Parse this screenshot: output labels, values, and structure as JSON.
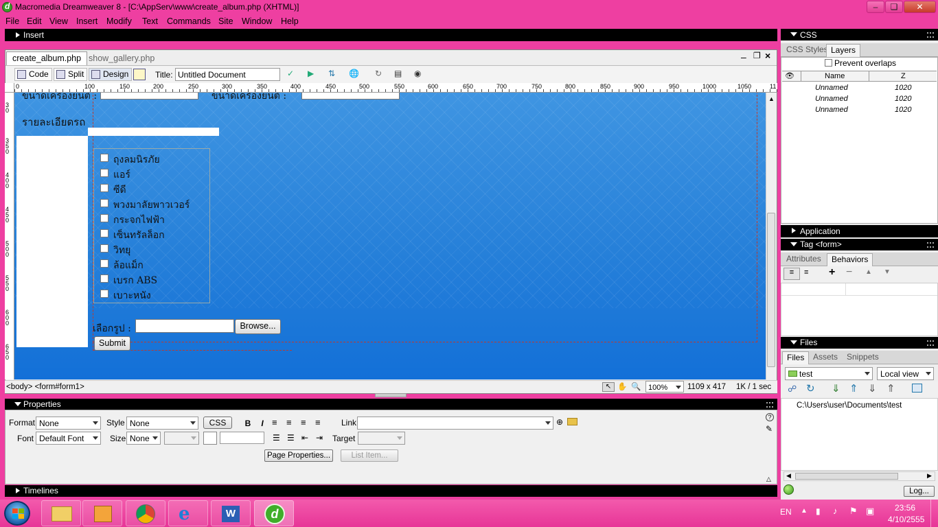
{
  "window": {
    "title": "Macromedia Dreamweaver 8 - [C:\\AppServ\\www\\create_album.php (XHTML)]",
    "minimize": "–",
    "restore": "❏",
    "close": "✕"
  },
  "menu": [
    "File",
    "Edit",
    "View",
    "Insert",
    "Modify",
    "Text",
    "Commands",
    "Site",
    "Window",
    "Help"
  ],
  "insert_panel": {
    "label": "Insert"
  },
  "doc": {
    "tabs": [
      "create_album.php",
      "show_gallery.php"
    ],
    "toolbar": {
      "code": "Code",
      "split": "Split",
      "design": "Design",
      "title_label": "Title:",
      "title_value": "Untitled Document"
    },
    "ruler_h": [
      "0",
      "50",
      "100",
      "150",
      "200",
      "250",
      "300",
      "350",
      "400",
      "450",
      "500",
      "550",
      "600",
      "650",
      "700",
      "750",
      "800",
      "850",
      "900",
      "950",
      "1000",
      "1050",
      "11"
    ],
    "ruler_v": [
      "3\n0",
      "3\n5\n0",
      "4\n0\n0",
      "4\n5\n0",
      "5\n0\n0",
      "5\n5\n0",
      "6\n0\n0",
      "6\n5\n0"
    ],
    "form": {
      "top_label_left": "ขนาดเครื่องยนต์ :",
      "top_label_right": "ขนาดเครื่องยนต์ :",
      "details_label": "รายละเอียดรถ",
      "options": [
        "ถุงลมนิรภัย",
        "แอร์",
        "ซีดี",
        "พวงมาลัยพาวเวอร์",
        "กระจกไฟฟ้า",
        "เซ็นทรัลล็อก",
        "วิทยุ",
        "ล้อแม็ก",
        "เบรก ABS",
        "เบาะหนัง"
      ],
      "choose_image_label": "เลือกรูป :",
      "browse": "Browse...",
      "submit": "Submit"
    },
    "status": {
      "tags": "<body> <form#form1>",
      "zoom": "100%",
      "size": "1109 x 417",
      "weight": "1K / 1 sec"
    }
  },
  "properties": {
    "header": "Properties",
    "format_label": "Format",
    "format_value": "None",
    "style_label": "Style",
    "style_value": "None",
    "css_button": "CSS",
    "bold": "B",
    "italic": "I",
    "link_label": "Link",
    "link_value": "",
    "font_label": "Font",
    "font_value": "Default Font",
    "size_label": "Size",
    "size_value": "None",
    "target_label": "Target",
    "page_properties": "Page Properties...",
    "list_item": "List Item..."
  },
  "timelines": {
    "label": "Timelines"
  },
  "css_panel": {
    "header": "CSS",
    "tabs": [
      "CSS Styles",
      "Layers"
    ],
    "prevent_overlaps": "Prevent overlaps",
    "columns": [
      "Name",
      "Z"
    ],
    "rows": [
      {
        "name": "Unnamed",
        "z": "1020"
      },
      {
        "name": "Unnamed",
        "z": "1020"
      },
      {
        "name": "Unnamed",
        "z": "1020"
      }
    ]
  },
  "application_panel": {
    "header": "Application"
  },
  "tag_panel": {
    "header": "Tag <form>",
    "tabs": [
      "Attributes",
      "Behaviors"
    ]
  },
  "files_panel": {
    "header": "Files",
    "tabs": [
      "Files",
      "Assets",
      "Snippets"
    ],
    "site": "test",
    "view": "Local view",
    "path": "C:\\Users\\user\\Documents\\test",
    "log": "Log..."
  },
  "taskbar": {
    "lang": "EN",
    "time": "23:56",
    "date": "4/10/2555"
  },
  "colors": {
    "accent": "#ee3fa1",
    "canvas": "#2680d9"
  }
}
